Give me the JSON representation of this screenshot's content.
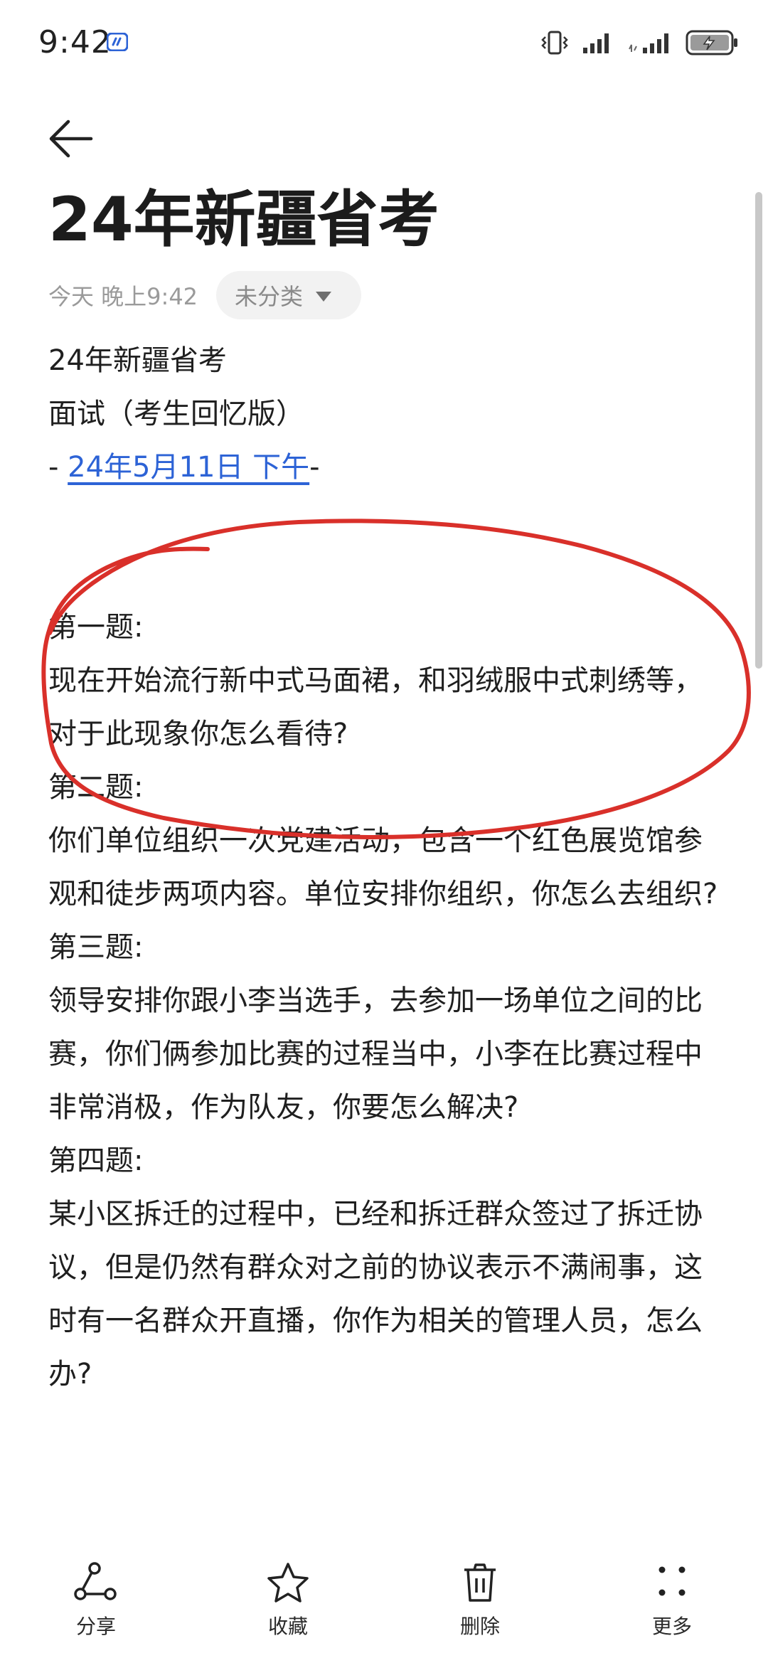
{
  "status_bar": {
    "time": "9:42",
    "battery_level": 0.6
  },
  "note": {
    "title": "24年新疆省考",
    "date": "今天 晚上9:42",
    "category": "未分类",
    "body": {
      "line1": "24年新疆省考",
      "line2": "面试（考生回忆版）",
      "dash_prefix": "- ",
      "date_link": "24年5月11日 下午",
      "dash_suffix": "-",
      "q1_heading": "第一题:",
      "q1_text": "现在开始流行新中式马面裙，和羽绒服中式刺绣等，对于此现象你怎么看待?",
      "q2_heading": "第二题:",
      "q2_text": "你们单位组织一次党建活动，包含一个红色展览馆参观和徒步两项内容。单位安排你组织，你怎么去组织?",
      "q3_heading": "第三题:",
      "q3_text": "领导安排你跟小李当选手，去参加一场单位之间的比赛，你们俩参加比赛的过程当中，小李在比赛过程中非常消极，作为队友，你要怎么解决?",
      "q4_heading": "第四题:",
      "q4_text": "某小区拆迁的过程中，已经和拆迁群众签过了拆迁协议，但是仍然有群众对之前的协议表示不满闹事，这时有一名群众开直播，你作为相关的管理人员，怎么办?"
    }
  },
  "bottom_bar": {
    "share": "分享",
    "favorite": "收藏",
    "delete": "删除",
    "more": "更多"
  },
  "colors": {
    "link": "#2d63d6",
    "annotation": "#d9302a"
  }
}
